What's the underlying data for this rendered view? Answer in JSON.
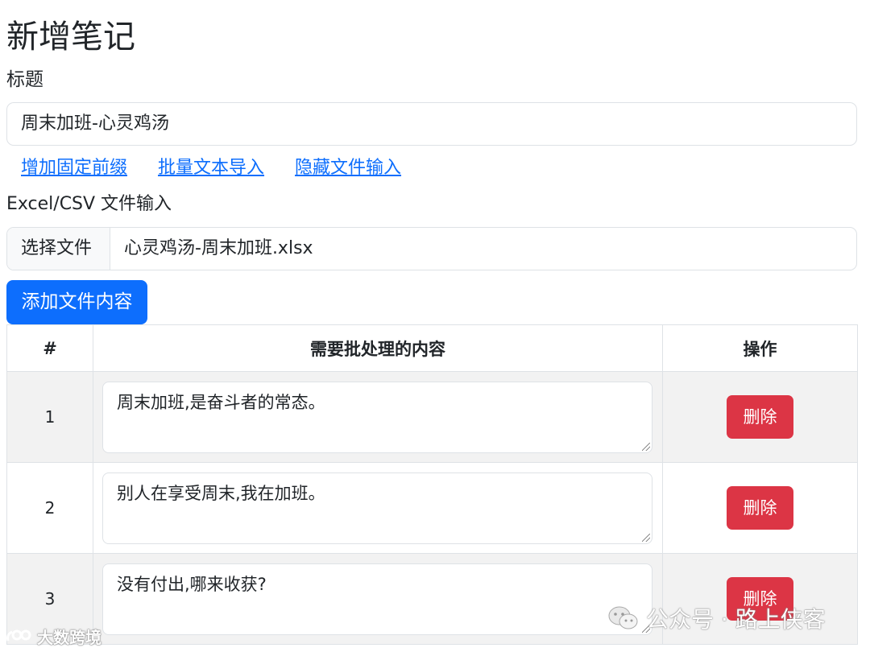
{
  "page": {
    "title": "新增笔记"
  },
  "form": {
    "title_label": "标题",
    "title_value": "周末加班-心灵鸡汤",
    "links": [
      "增加固定前缀",
      "批量文本导入",
      "隐藏文件输入"
    ],
    "file_label": "Excel/CSV 文件输入",
    "file_button": "选择文件",
    "file_name": "心灵鸡汤-周末加班.xlsx",
    "add_button": "添加文件内容"
  },
  "table": {
    "headers": [
      "#",
      "需要批处理的内容",
      "操作"
    ],
    "rows": [
      {
        "index": "1",
        "content": "周末加班,是奋斗者的常态。",
        "action": "删除"
      },
      {
        "index": "2",
        "content": "别人在享受周末,我在加班。",
        "action": "删除"
      },
      {
        "index": "3",
        "content": "没有付出,哪来收获?",
        "action": "删除"
      }
    ]
  },
  "watermarks": {
    "left": "大数跨境",
    "right": "公众号 · 路上侠客"
  },
  "colors": {
    "primary": "#0d6efd",
    "danger": "#dc3545",
    "striped_row": "#f2f2f2",
    "border": "#dee2e6"
  }
}
